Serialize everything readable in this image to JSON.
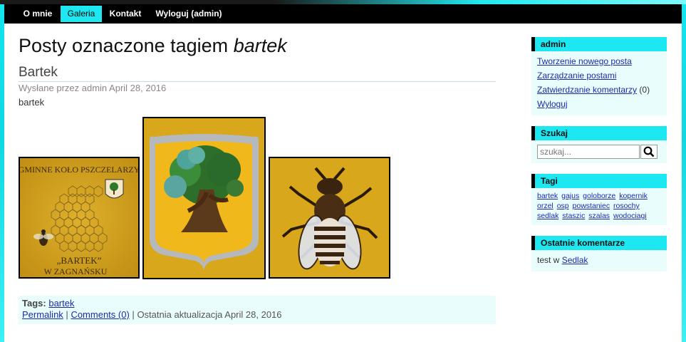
{
  "nav": {
    "items": [
      {
        "label": "O mnie",
        "active": false
      },
      {
        "label": "Galeria",
        "active": true
      },
      {
        "label": "Kontakt",
        "active": false
      },
      {
        "label": "Wyloguj (admin)",
        "active": false
      }
    ]
  },
  "main": {
    "heading_prefix": "Posty oznaczone tagiem",
    "heading_tag": "bartek",
    "post": {
      "title": "Bartek",
      "meta": "Wysłane przez admin April 28, 2016",
      "body": "bartek",
      "images": [
        {
          "name": "honeycomb-emblem-photo",
          "text_top": "GMINNE KOŁO PSZCZELARZY",
          "text_bottom1": "„BARTEK”",
          "text_bottom2": "W ZAGNAŃSKU"
        },
        {
          "name": "oak-tree-crest-photo"
        },
        {
          "name": "embroidered-bee-photo"
        }
      ],
      "footer": {
        "tags_label": "Tags:",
        "tag": "bartek",
        "permalink": "Permalink",
        "separator": "|",
        "comments": "Comments (0)",
        "updated": "Ostatnia aktualizacja April 28, 2016"
      }
    }
  },
  "sidebar": {
    "admin": {
      "title": "admin",
      "links": [
        {
          "label": "Tworzenie nowego posta",
          "suffix": ""
        },
        {
          "label": "Zarządzanie postami",
          "suffix": ""
        },
        {
          "label": "Zatwierdzanie komentarzy",
          "suffix": " (0)"
        },
        {
          "label": "Wyloguj",
          "suffix": ""
        }
      ]
    },
    "search": {
      "title": "Szukaj",
      "placeholder": "szukaj...",
      "icon": "search-icon"
    },
    "tags": {
      "title": "Tagi",
      "items": [
        "bartek",
        "gajus",
        "goloborze",
        "kopernik",
        "orzel",
        "osp",
        "powstaniec",
        "rosochy",
        "sedlak",
        "staszic",
        "szalas",
        "wodociagi"
      ]
    },
    "comments": {
      "title": "Ostatnie komentarze",
      "text": "test w",
      "link": "Sedlak"
    }
  },
  "colors": {
    "accent": "#1de7f0",
    "navbar": "#000000",
    "link": "#1b2ba8",
    "panel": "#eafdfd"
  }
}
